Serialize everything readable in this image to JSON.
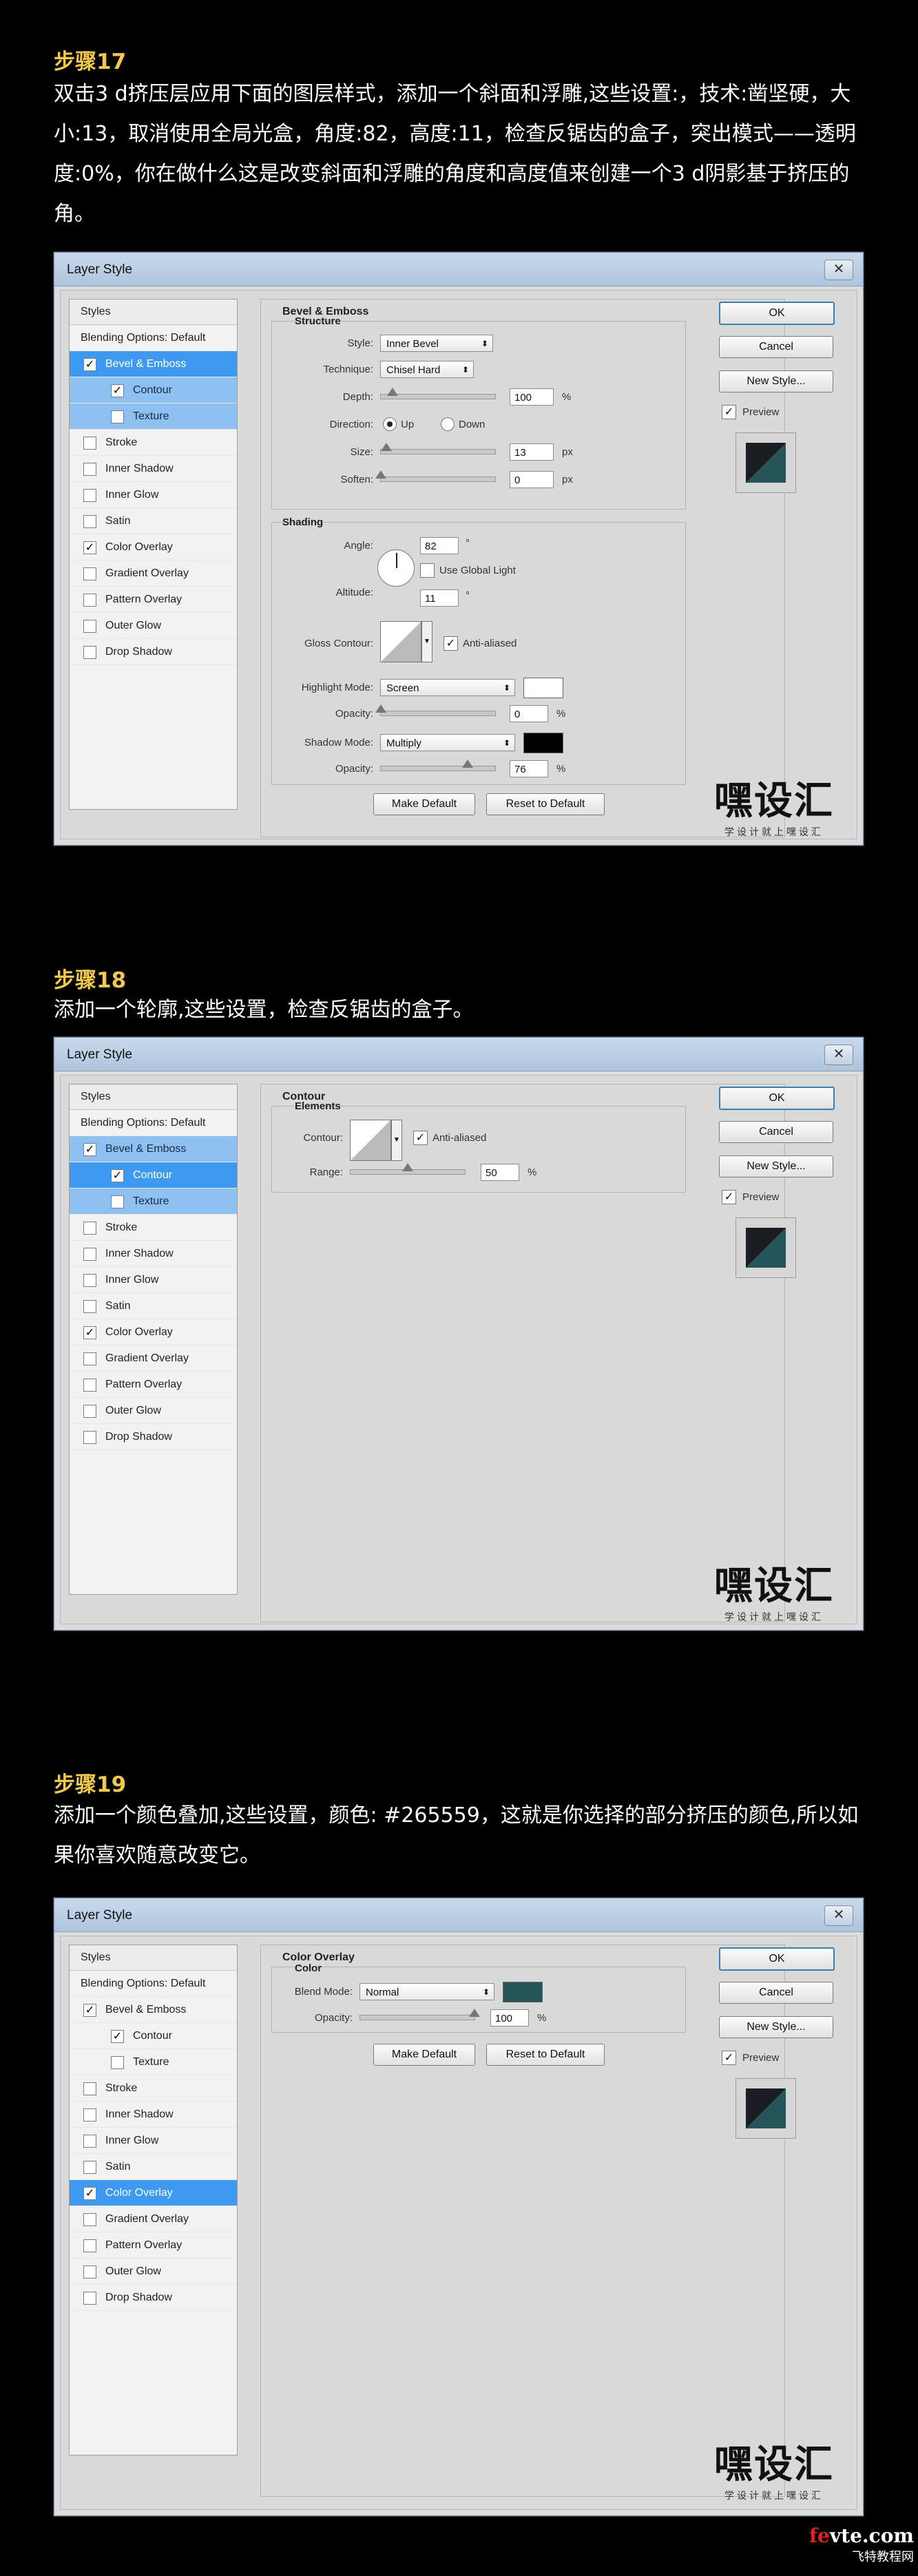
{
  "steps": [
    {
      "title": "步骤17",
      "desc": "双击3 d挤压层应用下面的图层样式，添加一个斜面和浮雕,这些设置:，技术:凿坚硬，大小:13，取消使用全局光盒，角度:82，高度:11，检查反锯齿的盒子，突出模式——透明度:0%，你在做什么这是改变斜面和浮雕的角度和高度值来创建一个3 d阴影基于挤压的角。"
    },
    {
      "title": "步骤18",
      "desc": "添加一个轮廓,这些设置，检查反锯齿的盒子。"
    },
    {
      "title": "步骤19",
      "desc": "添加一个颜色叠加,这些设置，颜色: #265559，这就是你选择的部分挤压的颜色,所以如果你喜欢随意改变它。"
    }
  ],
  "dialog": {
    "title": "Layer Style",
    "close": "✕",
    "ok": "OK",
    "cancel": "Cancel",
    "new_style": "New Style...",
    "preview": "Preview",
    "preview_color": "#265559",
    "styles_header": "Styles",
    "blending": "Blending Options: Default",
    "style_items": [
      "Bevel & Emboss",
      "Contour",
      "Texture",
      "Stroke",
      "Inner Shadow",
      "Inner Glow",
      "Satin",
      "Color Overlay",
      "Gradient Overlay",
      "Pattern Overlay",
      "Outer Glow",
      "Drop Shadow"
    ],
    "make_default": "Make Default",
    "reset_default": "Reset to Default"
  },
  "bevel": {
    "panel": "Bevel & Emboss",
    "structure": "Structure",
    "style_label": "Style:",
    "style_value": "Inner Bevel",
    "technique_label": "Technique:",
    "technique_value": "Chisel Hard",
    "depth_label": "Depth:",
    "depth_value": "100",
    "depth_unit": "%",
    "depth_level": 0.1,
    "direction_label": "Direction:",
    "up": "Up",
    "down": "Down",
    "size_label": "Size:",
    "size_value": "13",
    "size_unit": "px",
    "size_level": 0.05,
    "soften_label": "Soften:",
    "soften_value": "0",
    "soften_unit": "px",
    "shading": "Shading",
    "angle_label": "Angle:",
    "angle_value": "82",
    "deg": "°",
    "global_light": "Use Global Light",
    "altitude_label": "Altitude:",
    "altitude_value": "11",
    "gloss_label": "Gloss Contour:",
    "anti_aliased": "Anti-aliased",
    "highlight_label": "Highlight Mode:",
    "highlight_value": "Screen",
    "highlight_color": "#ffffff",
    "hopacity_label": "Opacity:",
    "hopacity_value": "0",
    "hopacity_unit": "%",
    "shadow_label": "Shadow Mode:",
    "shadow_value": "Multiply",
    "shadow_color": "#000000",
    "sopacity_label": "Opacity:",
    "sopacity_value": "76",
    "sopacity_unit": "%",
    "sopacity_level": 0.76
  },
  "contour": {
    "panel": "Contour",
    "elements": "Elements",
    "contour_label": "Contour:",
    "anti_aliased": "Anti-aliased",
    "range_label": "Range:",
    "range_value": "50",
    "range_unit": "%",
    "range_level": 0.5
  },
  "overlay": {
    "panel": "Color Overlay",
    "color": "Color",
    "blend_label": "Blend Mode:",
    "blend_value": "Normal",
    "blend_color": "#265559",
    "opacity_label": "Opacity:",
    "opacity_value": "100",
    "opacity_unit": "%",
    "opacity_level": 1.0
  },
  "logo": {
    "main": "嘿设汇",
    "sub": "学设计就上嘿设汇"
  },
  "watermark": {
    "site_a": "fe",
    "site_b": "vte",
    "site_c": ".com",
    "cn": "飞特教程网"
  }
}
